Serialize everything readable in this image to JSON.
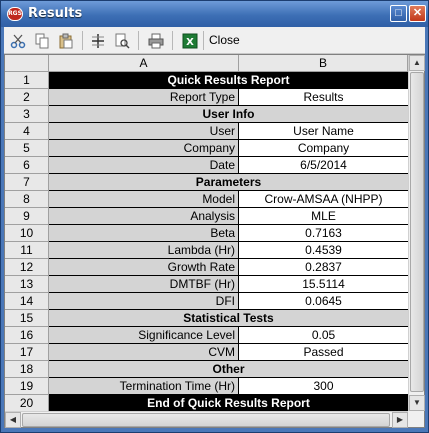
{
  "window": {
    "title": "Results",
    "app_icon_text": "RGS",
    "maximize_icon": "maximize-icon",
    "close_icon": "close-icon",
    "accent_color": "#3d6fb5"
  },
  "toolbar": {
    "icons": [
      "cut-icon",
      "copy-icon",
      "paste-icon",
      "split-icon",
      "find-icon",
      "print-icon",
      "excel-icon"
    ],
    "close_label": "Close"
  },
  "sheet": {
    "columns": [
      "A",
      "B"
    ],
    "rows": [
      {
        "num": "1",
        "type": "black",
        "text": "Quick Results Report"
      },
      {
        "num": "2",
        "type": "pair",
        "a": "Report Type",
        "b": "Results"
      },
      {
        "num": "3",
        "type": "section",
        "text": "User Info"
      },
      {
        "num": "4",
        "type": "pair",
        "a": "User",
        "b": "User Name"
      },
      {
        "num": "5",
        "type": "pair",
        "a": "Company",
        "b": "Company"
      },
      {
        "num": "6",
        "type": "pair",
        "a": "Date",
        "b": "6/5/2014"
      },
      {
        "num": "7",
        "type": "section",
        "text": "Parameters"
      },
      {
        "num": "8",
        "type": "pair",
        "a": "Model",
        "b": "Crow-AMSAA (NHPP)"
      },
      {
        "num": "9",
        "type": "pair",
        "a": "Analysis",
        "b": "MLE"
      },
      {
        "num": "10",
        "type": "pair",
        "a": "Beta",
        "b": "0.7163"
      },
      {
        "num": "11",
        "type": "pair",
        "a": "Lambda (Hr)",
        "b": "0.4539"
      },
      {
        "num": "12",
        "type": "pair",
        "a": "Growth Rate",
        "b": "0.2837"
      },
      {
        "num": "13",
        "type": "pair",
        "a": "DMTBF (Hr)",
        "b": "15.5114"
      },
      {
        "num": "14",
        "type": "pair",
        "a": "DFI",
        "b": "0.0645"
      },
      {
        "num": "15",
        "type": "section",
        "text": "Statistical Tests"
      },
      {
        "num": "16",
        "type": "pair",
        "a": "Significance Level",
        "b": "0.05"
      },
      {
        "num": "17",
        "type": "pair",
        "a": "CVM",
        "b": "Passed"
      },
      {
        "num": "18",
        "type": "section",
        "text": "Other"
      },
      {
        "num": "19",
        "type": "pair",
        "a": "Termination Time (Hr)",
        "b": "300"
      },
      {
        "num": "20",
        "type": "black",
        "text": "End of Quick Results Report"
      }
    ]
  }
}
